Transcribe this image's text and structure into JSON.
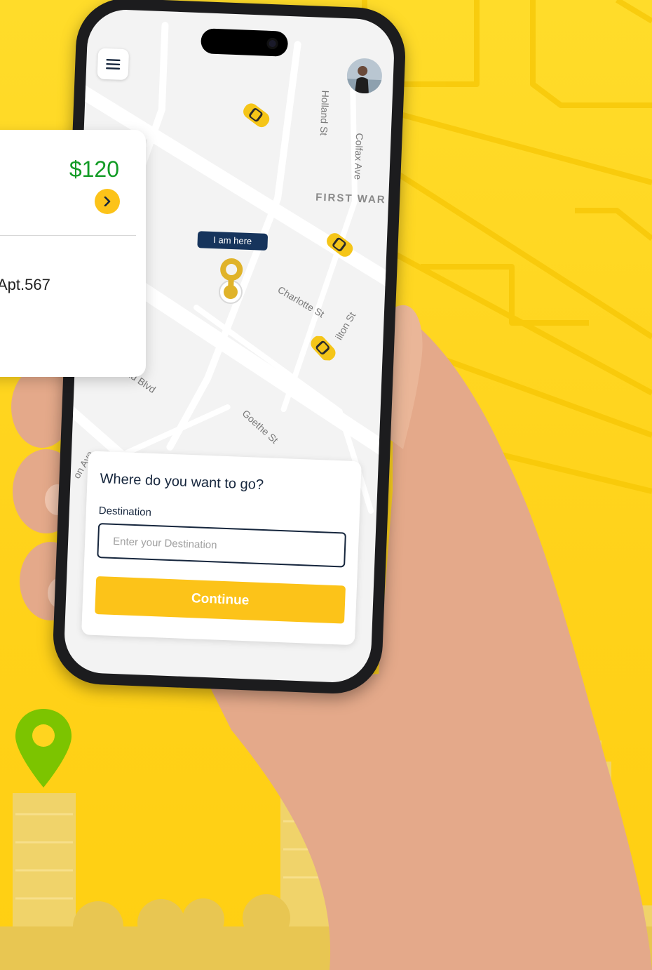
{
  "fare_card": {
    "price": "$120",
    "address_fragment": "Apt.567"
  },
  "map": {
    "streets": [
      "Holland St",
      "Colfax Ave",
      "Charlotte St",
      "ilton St",
      "nd Blvd",
      "Goethe St",
      "on Ave"
    ],
    "district": "FIRST WAR",
    "location_tag": "I am here"
  },
  "sheet": {
    "title": "Where do you want to go?",
    "destination_label": "Destination",
    "destination_placeholder": "Enter your Destination",
    "destination_value": "",
    "continue_label": "Continue"
  },
  "colors": {
    "background": "#ffd41f",
    "accent": "#fcc319",
    "navy": "#16345c",
    "price_green": "#129b25",
    "marker_green": "#7cc400"
  }
}
